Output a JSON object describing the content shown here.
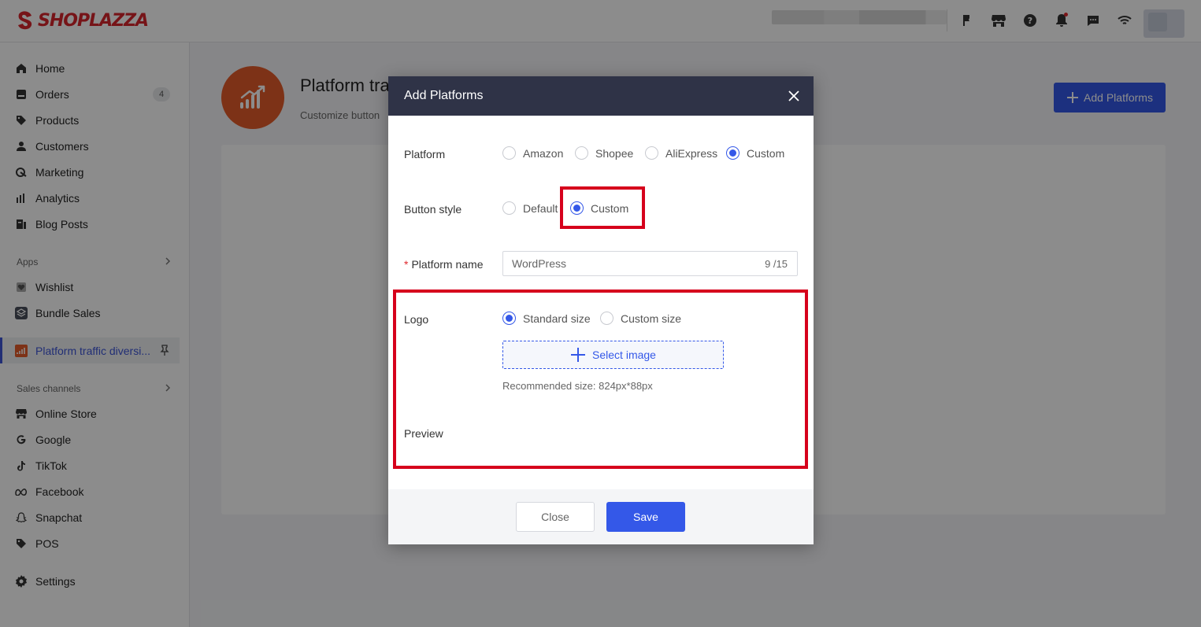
{
  "brand": {
    "name": "SHOPLAZZA",
    "color": "#d8262c"
  },
  "topbar": {
    "icons": [
      "flag-icon",
      "store-icon",
      "help-icon",
      "bell-icon",
      "message-icon",
      "wifi-icon"
    ]
  },
  "sidebar": {
    "main_items": [
      {
        "label": "Home",
        "icon": "home-icon"
      },
      {
        "label": "Orders",
        "icon": "orders-icon",
        "badge": "4"
      },
      {
        "label": "Products",
        "icon": "tag-icon"
      },
      {
        "label": "Customers",
        "icon": "person-icon"
      },
      {
        "label": "Marketing",
        "icon": "marketing-icon"
      },
      {
        "label": "Analytics",
        "icon": "analytics-icon"
      },
      {
        "label": "Blog Posts",
        "icon": "blog-icon"
      }
    ],
    "apps_label": "Apps",
    "apps": [
      {
        "label": "Wishlist",
        "icon": "wishlist-icon"
      },
      {
        "label": "Bundle Sales",
        "icon": "bundle-icon"
      },
      {
        "label": "Platform traffic diversi...",
        "icon": "traffic-icon"
      }
    ],
    "sales_label": "Sales channels",
    "channels": [
      {
        "label": "Online Store",
        "icon": "store-icon"
      },
      {
        "label": "Google",
        "icon": "google-icon"
      },
      {
        "label": "TikTok",
        "icon": "tiktok-icon"
      },
      {
        "label": "Facebook",
        "icon": "meta-icon"
      },
      {
        "label": "Snapchat",
        "icon": "snapchat-icon"
      },
      {
        "label": "POS",
        "icon": "pos-icon"
      }
    ],
    "settings": {
      "label": "Settings",
      "icon": "gear-icon"
    }
  },
  "main": {
    "title": "Platform tra",
    "subtitle": "Customize button",
    "add_button": "Add Platforms"
  },
  "modal": {
    "title": "Add Platforms",
    "platform_label": "Platform",
    "platform_options": [
      "Amazon",
      "Shopee",
      "AliExpress",
      "Custom"
    ],
    "platform_selected": "Custom",
    "button_style_label": "Button style",
    "button_style_options": [
      "Default",
      "Custom"
    ],
    "button_style_selected": "Custom",
    "required_mark": "*",
    "platform_name_label": "Platform name",
    "platform_name_value": "WordPress",
    "platform_name_counter": "9 /15",
    "logo_label": "Logo",
    "logo_options": [
      "Standard size",
      "Custom size"
    ],
    "logo_selected": "Standard size",
    "select_image": "Select image",
    "recommended": "Recommended size: 824px*88px",
    "preview_label": "Preview",
    "close_button": "Close",
    "save_button": "Save"
  },
  "colors": {
    "accent": "#3458e8",
    "highlight": "#d6001c",
    "header": "#2f3347"
  }
}
